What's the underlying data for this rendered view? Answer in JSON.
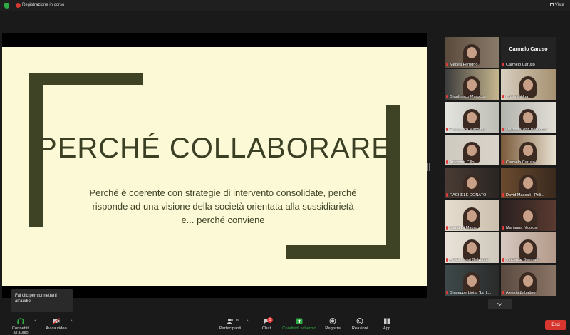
{
  "topbar": {
    "recording_label": "Registrazione in corso",
    "view_label": "Vista"
  },
  "slide": {
    "title": "PERCHÉ COLLABORARE",
    "body_line1": "Perché è coerente con strategie di intervento consolidate, perché",
    "body_line2": "risponde ad una visione della società orientata alla sussidiarietà",
    "body_line3": "e... perché conviene"
  },
  "gallery": {
    "featured_name": "Carmelo Caruso",
    "participants": [
      {
        "name": "Medea Ferrigno"
      },
      {
        "name": "Carmelo Caruso"
      },
      {
        "name": "Gianfranco Marocchi"
      },
      {
        "name": "Cristina Alga"
      },
      {
        "name": "Francesco Mannino"
      },
      {
        "name": "Martina Conti Bellocchi"
      },
      {
        "name": "Antonino Cillo"
      },
      {
        "name": "Carmelo Caruso"
      },
      {
        "name": "RACHELE DONATO"
      },
      {
        "name": "David Mascali - Prili..."
      },
      {
        "name": "Laura Di Mauro"
      },
      {
        "name": "Marianna Nicolosi"
      },
      {
        "name": "Agata Lipari Galvagno"
      },
      {
        "name": "Vincenza Bonanno"
      },
      {
        "name": "Giuseppe Liotta \"La L..."
      },
      {
        "name": "Alessia Zabatino"
      }
    ]
  },
  "tooltip": {
    "line1": "Fai clic per connetterti",
    "line2": "all'audio"
  },
  "toolbar": {
    "audio": "Connettiti all'audio",
    "video": "Avvia video",
    "participants": "Partecipanti",
    "participants_count": "19",
    "chat": "Chat",
    "chat_badge": "1",
    "share": "Condividi schermo",
    "record": "Registra",
    "reactions": "Reazioni",
    "apps": "App",
    "end": "Esci"
  },
  "colors": {
    "share_green": "#2eab43",
    "end_red": "#d7362f",
    "slide_bg": "#fbf9d6",
    "slide_accent": "#3f4326",
    "active_speaker": "#b9d332"
  }
}
